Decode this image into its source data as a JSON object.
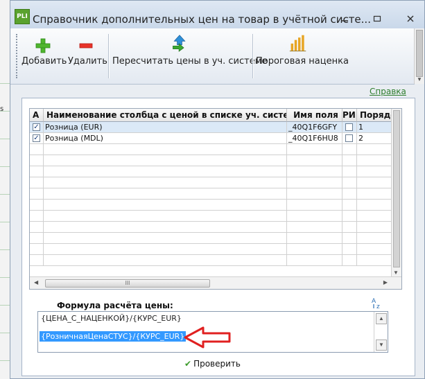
{
  "window": {
    "title": "Справочник дополнительных цен на товар в учётной систе...",
    "icon_label": "PLI",
    "minimize_icon": "minimize-icon",
    "maximize_icon": "maximize-icon",
    "close_icon": "close-icon"
  },
  "background": {
    "cell_text": "s"
  },
  "toolbar": {
    "add_label": "Добавить",
    "delete_label": "Удалить",
    "recalc_label": "Пересчитать цены в уч. системе",
    "threshold_label": "Пороговая наценка",
    "icons": [
      "plus-icon",
      "minus-icon",
      "recalc-icon",
      "bar-chart-icon"
    ]
  },
  "help_link": "Справка",
  "grid": {
    "headers": [
      "А",
      "Наименование столбца с ценой в списке уч. системы",
      "Имя поля",
      "РИЦ",
      "Порядо"
    ],
    "rows": [
      {
        "active": true,
        "name": "Розница (EUR)",
        "field": "_40Q1F6GFY",
        "ric": false,
        "order": "1"
      },
      {
        "active": true,
        "name": "Розница (MDL)",
        "field": "_40Q1F6HU8",
        "ric": false,
        "order": "2"
      }
    ],
    "scroll_thumb_label": "III"
  },
  "formula": {
    "label": "Формула расчёта цены:",
    "line1": "{ЦЕНА_С_НАЦЕНКОЙ}/{КУРС_EUR}",
    "line2_selected": "{РозничнаяЦенаСТУС}/{КУРС_EUR}"
  },
  "verify_label": "Проверить",
  "colors": {
    "accent_link": "#2d7d2d",
    "selection": "#3399ff",
    "annotation_arrow": "#e02020"
  }
}
